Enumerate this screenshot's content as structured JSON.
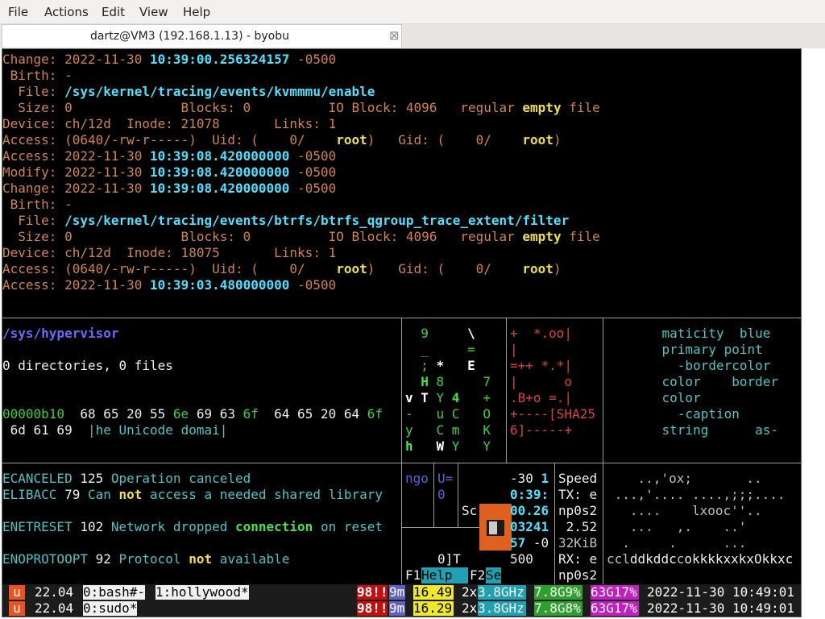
{
  "menubar": {
    "items": [
      "File",
      "Actions",
      "Edit",
      "View",
      "Help"
    ]
  },
  "tab": {
    "title": "dartz@VM3 (192.168.1.13) - byobu",
    "close": "⊠"
  },
  "terminal": {
    "top_lines": [
      [
        [
          "o",
          "Change: 2022-11-30 "
        ],
        [
          "cb",
          "10:39:00.256324157"
        ],
        [
          "o",
          " -0500"
        ]
      ],
      [
        [
          "o",
          " Birth: -"
        ]
      ],
      [
        [
          "o",
          "  File: "
        ],
        [
          "cb",
          "/sys/kernel/tracing/events/kvmmmu/enable"
        ]
      ],
      [
        [
          "o",
          "  Size: 0              Blocks: 0          IO Block: 4096   regular "
        ],
        [
          "y",
          "empty"
        ],
        [
          "o",
          " file"
        ]
      ],
      [
        [
          "o",
          "Device: ch/12d  Inode: 21078       Links: 1"
        ]
      ],
      [
        [
          "o",
          "Access: (0640/-rw-r-----)  Uid: (    0/    "
        ],
        [
          "y",
          "root"
        ],
        [
          "o",
          ")   Gid: (    0/    "
        ],
        [
          "y",
          "root"
        ],
        [
          "o",
          ")"
        ]
      ],
      [
        [
          "o",
          "Access: 2022-11-30 "
        ],
        [
          "cb",
          "10:39:08.420000000"
        ],
        [
          "o",
          " -0500"
        ]
      ],
      [
        [
          "o",
          "Modify: 2022-11-30 "
        ],
        [
          "cb",
          "10:39:08.420000000"
        ],
        [
          "o",
          " -0500"
        ]
      ],
      [
        [
          "o",
          "Change: 2022-11-30 "
        ],
        [
          "cb",
          "10:39:08.420000000"
        ],
        [
          "o",
          " -0500"
        ]
      ],
      [
        [
          "o",
          " Birth: -"
        ]
      ],
      [
        [
          "o",
          "  File: "
        ],
        [
          "cb",
          "/sys/kernel/tracing/events/btrfs/btrfs_qgroup_trace_extent/filter"
        ]
      ],
      [
        [
          "o",
          "  Size: 0              Blocks: 0          IO Block: 4096   regular "
        ],
        [
          "y",
          "empty"
        ],
        [
          "o",
          " file"
        ]
      ],
      [
        [
          "o",
          "Device: ch/12d  Inode: 18075       Links: 1"
        ]
      ],
      [
        [
          "o",
          "Access: (0640/-rw-r-----)  Uid: (    0/    "
        ],
        [
          "y",
          "root"
        ],
        [
          "o",
          ")   Gid: (    0/    "
        ],
        [
          "y",
          "root"
        ],
        [
          "o",
          ")"
        ]
      ],
      [
        [
          "o",
          "Access: 2022-11-30 "
        ],
        [
          "cb",
          "10:39:03.480000000"
        ],
        [
          "o",
          " -0500"
        ]
      ]
    ],
    "pane_left1": [
      [
        [
          "b",
          "/sys/hypervisor"
        ]
      ],
      [],
      [
        [
          "w",
          "0 directories, 0 files"
        ]
      ],
      [],
      [],
      [
        [
          "g",
          "00000b10  "
        ],
        [
          "w",
          "68 65 20 55 "
        ],
        [
          "g",
          "6e"
        ],
        [
          "w",
          " 69 63 "
        ],
        [
          "g",
          "6f"
        ],
        [
          "w",
          "  64 65 20 64 "
        ],
        [
          "g",
          "6f"
        ]
      ],
      [
        [
          "w",
          " 6d 61 69  "
        ],
        [
          "c",
          "|he Unicode domai|"
        ]
      ]
    ],
    "pane_matrix": [
      [
        [
          "g",
          "  9     "
        ],
        [
          "wb",
          "\\"
        ]
      ],
      [
        [
          "g",
          "  _     ="
        ]
      ],
      [
        [
          "g",
          "  ; "
        ],
        [
          "wb",
          "*"
        ],
        [
          "g",
          "   "
        ],
        [
          "wb",
          "E"
        ]
      ],
      [
        [
          "gb",
          "  H "
        ],
        [
          "g",
          "8     7"
        ]
      ],
      [
        [
          "wb",
          "v T "
        ],
        [
          "g",
          "Y "
        ],
        [
          "gb",
          "4"
        ],
        [
          "g",
          "   +"
        ]
      ],
      [
        [
          "g",
          "-   u C   O"
        ]
      ],
      [
        [
          "g",
          "y   C m   K"
        ]
      ],
      [
        [
          "gb",
          "h   "
        ],
        [
          "wb",
          "W"
        ],
        [
          "g",
          " Y   Y"
        ]
      ]
    ],
    "pane_sha": [
      [
        [
          "r",
          "+  *.oo|"
        ]
      ],
      [
        [
          "r",
          "|"
        ]
      ],
      [
        [
          "r",
          "=++ *.*|"
        ]
      ],
      [
        [
          "r",
          "|      o"
        ]
      ],
      [
        [
          "r",
          ".B+o =.|"
        ]
      ],
      [
        [
          "r",
          "+----[SHA25"
        ]
      ],
      [
        [
          "r",
          "6]-----+"
        ]
      ]
    ],
    "pane_css": [
      [
        [
          "c",
          "    maticity  blue"
        ]
      ],
      [
        [
          "c",
          "    primary point"
        ]
      ],
      [
        [
          "c",
          "      -bordercolor"
        ]
      ],
      [
        [
          "c",
          "    color    border"
        ]
      ],
      [
        [
          "c",
          "    color"
        ]
      ],
      [
        [
          "c",
          "      -caption"
        ]
      ],
      [
        [
          "c",
          "    string      as-"
        ]
      ]
    ],
    "pane_errno": [
      [
        [
          "c",
          "ECANCELED "
        ],
        [
          "w",
          "125 "
        ],
        [
          "c",
          "Operation canceled"
        ]
      ],
      [
        [
          "c",
          "ELIBACC "
        ],
        [
          "w",
          "79 "
        ],
        [
          "c",
          "Can "
        ],
        [
          "y",
          "not"
        ],
        [
          "c",
          " access a needed shared library"
        ]
      ],
      [],
      [
        [
          "c",
          "ENETRESET "
        ],
        [
          "w",
          "102 "
        ],
        [
          "c",
          "Network dropped "
        ],
        [
          "gb",
          "connection"
        ],
        [
          "c",
          " on reset"
        ]
      ],
      [],
      [
        [
          "c",
          "ENOPROTOOPT "
        ],
        [
          "w",
          "92 "
        ],
        [
          "c",
          "Protocol "
        ],
        [
          "y",
          "not"
        ],
        [
          "c",
          " available"
        ]
      ]
    ],
    "pane_small1": "ngo",
    "pane_small2": [
      "U=",
      "0"
    ],
    "pane_screen_label": "Scree",
    "pane_cursor_text": "0]T",
    "pane_fkeys": [
      [
        "w",
        "F1"
      ],
      [
        "hl",
        "Help  "
      ],
      [
        "w",
        "F2"
      ],
      [
        "hl",
        "Se"
      ]
    ],
    "pane_numbers": [
      [
        [
          "w",
          "-30 "
        ],
        [
          "cb",
          "1"
        ]
      ],
      [
        [
          "cb",
          "0:39:"
        ]
      ],
      [
        [
          "cb",
          "00.26"
        ]
      ],
      [
        [
          "cb",
          "03241"
        ]
      ],
      [
        [
          "cb",
          "57"
        ],
        [
          "w",
          " -0"
        ]
      ],
      [
        [
          "w",
          "500"
        ]
      ]
    ],
    "pane_net": [
      [
        [
          "w",
          "Speed"
        ]
      ],
      [
        [
          "w",
          "TX: e"
        ]
      ],
      [
        [
          "w",
          "np0s2"
        ]
      ],
      [
        [
          "w",
          " 2.52"
        ]
      ],
      [
        [
          "gr",
          "32KiB"
        ]
      ],
      [
        [
          "w",
          "RX: e"
        ]
      ],
      [
        [
          "w",
          "np0s2"
        ]
      ]
    ],
    "pane_ascii": [
      [
        [
          "gr",
          "    ..,'ox;       .."
        ]
      ],
      [
        [
          "gr",
          " ...,'.... ....,;;;...."
        ]
      ],
      [
        [
          "gr",
          "   ....    lxooc''.."
        ]
      ],
      [
        [
          "gr",
          "   ...   ,.    ..'"
        ]
      ],
      [
        [
          "gr",
          "  .     .      ..."
        ]
      ],
      [
        [
          "gr",
          "ccl"
        ],
        [
          "w",
          "ddkddc"
        ],
        [
          "gr",
          "c"
        ],
        [
          "w",
          "okkkkxxkxOkkxc"
        ]
      ]
    ]
  },
  "statusbar": {
    "rows": [
      {
        "logo": "u",
        "release": "22.04",
        "window_current": "0:bash#-",
        "window_other": "1:hollywood*",
        "updates": "98!!",
        "mem_unit": "9m",
        "load": "16.49",
        "cpu_count": "2x",
        "cpu_freq": "3.8GHz",
        "mem_total": "7.8G",
        "mem_pct": "9%",
        "disk_total": "63G",
        "disk_pct": "17%",
        "datetime": "2022-11-30 10:49:01"
      },
      {
        "logo": "u",
        "release": "22.04",
        "window_current": "0:sudo*",
        "window_other": "",
        "updates": "98!!",
        "mem_unit": "9m",
        "load": "16.29",
        "cpu_count": "2x",
        "cpu_freq": "3.8GHz",
        "mem_total": "7.8G",
        "mem_pct": "8%",
        "disk_total": "63G",
        "disk_pct": "17%",
        "datetime": "2022-11-30 10:49:01"
      }
    ]
  },
  "colors": {
    "terminal_bg": "#000000",
    "orange_text": "#d2844a",
    "cyan_text": "#4cc4c8",
    "ubuntu_orange": "#e95420",
    "status_green": "#2ea02e",
    "status_magenta": "#c020c0",
    "status_cyan": "#20a0b0",
    "status_yellow": "#f0e830"
  }
}
